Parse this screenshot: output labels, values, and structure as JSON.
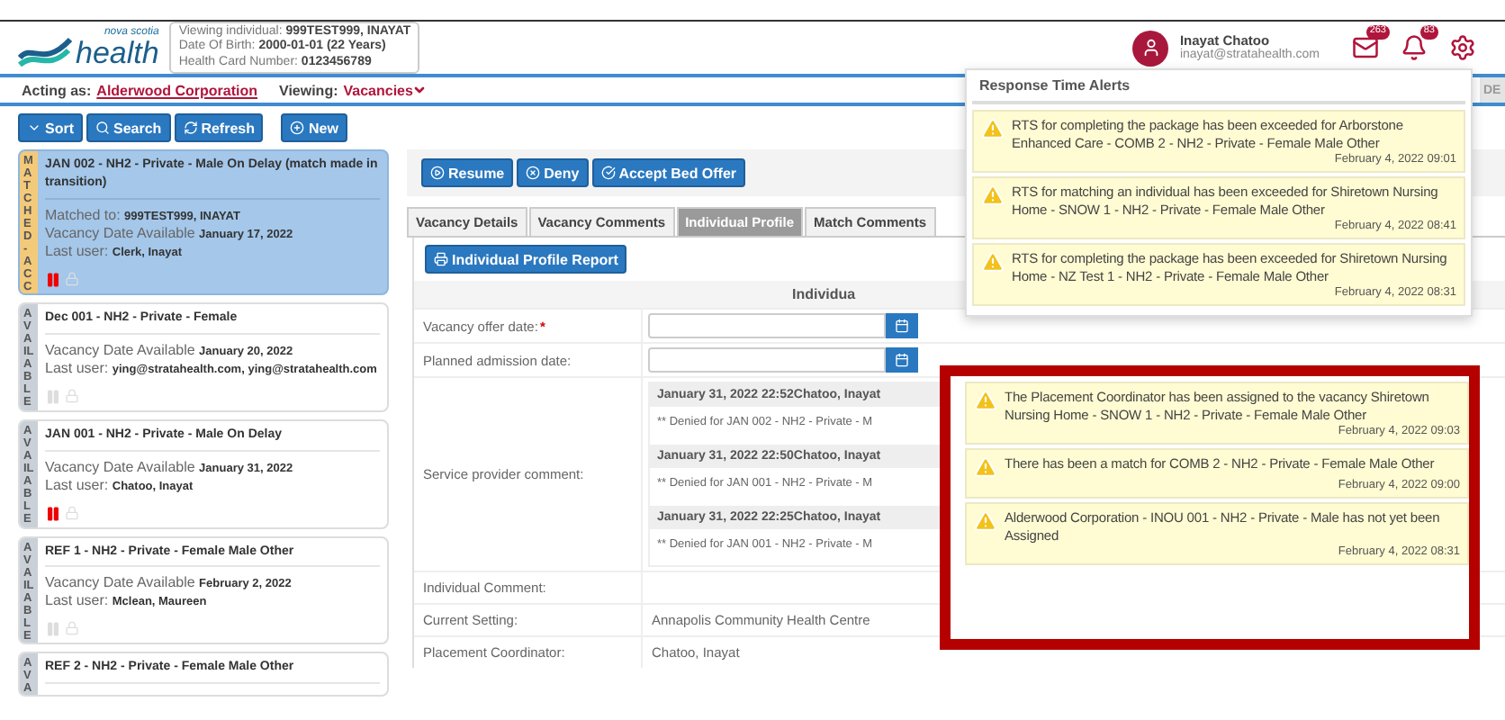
{
  "header": {
    "logo": {
      "small": "nova scotia",
      "large": "health"
    },
    "individual": [
      {
        "label": "Viewing individual:",
        "value": "999TEST999, INAYAT"
      },
      {
        "label": "Date Of Birth:",
        "value": "2000-01-01 (22 Years)"
      },
      {
        "label": "Health Card Number:",
        "value": "0123456789"
      }
    ],
    "user": {
      "name": "Inayat Chatoo",
      "email": "inayat@stratahealth.com"
    },
    "messages_count": "263",
    "alerts_count": "83",
    "env_tag": "DE"
  },
  "context_bar": {
    "acting_label": "Acting as:",
    "acting_value": "Alderwood Corporation",
    "viewing_label": "Viewing:",
    "viewing_value": "Vacancies"
  },
  "toolbar": [
    "Sort",
    "Search",
    "Refresh",
    "New"
  ],
  "vacancies": [
    {
      "status": "MATCHED-ACC",
      "kind": "matched",
      "selected": true,
      "title": "JAN 002 - NH2 - Private - Male On Delay (match made in transition)",
      "lines": [
        {
          "label": "Matched to:",
          "value": "999TEST999, INAYAT"
        },
        {
          "label": "Vacancy Date Available",
          "value": "January 17, 2022"
        },
        {
          "label": "Last user:",
          "value": "Clerk, Inayat"
        }
      ],
      "paused": true
    },
    {
      "status": "AVAILABLE",
      "kind": "available",
      "selected": false,
      "title": "Dec 001 - NH2 - Private - Female",
      "lines": [
        {
          "label": "Vacancy Date Available",
          "value": "January 20, 2022"
        },
        {
          "label": "Last user:",
          "value": "ying@stratahealth.com, ying@stratahealth.com"
        }
      ],
      "paused": false
    },
    {
      "status": "AVAILABLE",
      "kind": "available",
      "selected": false,
      "title": "JAN 001 - NH2 - Private - Male On Delay",
      "lines": [
        {
          "label": "Vacancy Date Available",
          "value": "January 31, 2022"
        },
        {
          "label": "Last user:",
          "value": "Chatoo, Inayat"
        }
      ],
      "paused": true
    },
    {
      "status": "AVAILABLE",
      "kind": "available",
      "selected": false,
      "title": "REF 1 - NH2 - Private - Female Male Other",
      "lines": [
        {
          "label": "Vacancy Date Available",
          "value": "February 2, 2022"
        },
        {
          "label": "Last user:",
          "value": "Mclean, Maureen"
        }
      ],
      "paused": false
    },
    {
      "status": "AVA",
      "kind": "available",
      "selected": false,
      "title": "REF 2 - NH2 - Private - Female Male Other"
    }
  ],
  "actions": [
    "Resume",
    "Deny",
    "Accept Bed Offer"
  ],
  "tabs": [
    {
      "label": "Vacancy Details",
      "selected": false
    },
    {
      "label": "Vacancy Comments",
      "selected": false
    },
    {
      "label": "Individual Profile",
      "selected": true
    },
    {
      "label": "Match Comments",
      "selected": false
    }
  ],
  "report_button": "Individual Profile Report",
  "profile": {
    "section_title": "Individua",
    "fields": [
      {
        "kind": "date",
        "label": "Vacancy offer date:",
        "required_mark": "*"
      },
      {
        "kind": "date",
        "label": "Planned admission date:"
      },
      {
        "kind": "comments",
        "label": "Service provider comment:",
        "comments": [
          {
            "header": "January 31, 2022 22:52Chatoo, Inayat",
            "text": "** Denied for JAN 002 - NH2 - Private - M"
          },
          {
            "header": "January 31, 2022 22:50Chatoo, Inayat",
            "text": "** Denied for JAN 001 - NH2 - Private - M"
          },
          {
            "header": "January 31, 2022 22:25Chatoo, Inayat",
            "text": "** Denied for JAN 001 - NH2 - Private - M"
          }
        ]
      },
      {
        "kind": "text",
        "label": "Individual Comment:"
      },
      {
        "kind": "text",
        "label": "Current Setting:",
        "value": "Annapolis Community Health Centre"
      },
      {
        "kind": "text",
        "label": "Placement Coordinator:",
        "value": "Chatoo, Inayat"
      }
    ]
  },
  "alerts_panel": {
    "title": "Response Time Alerts",
    "alerts": [
      {
        "text": "RTS for completing the package has been exceeded for Arborstone Enhanced Care - COMB 2 - NH2 - Private - Female Male Other",
        "time": "February 4, 2022 09:01"
      },
      {
        "text": "RTS for matching an individual has been exceeded for Shiretown Nursing Home - SNOW 1 - NH2 - Private - Female Male Other",
        "time": "February 4, 2022 08:41"
      },
      {
        "text": "RTS for completing the package has been exceeded for Shiretown Nursing Home - NZ Test 1 - NH2 - Private - Female Male Other",
        "time": "February 4, 2022 08:31"
      }
    ]
  },
  "highlighted_alerts": [
    {
      "text": "The Placement Coordinator has been assigned to the vacancy Shiretown Nursing Home - SNOW 1 - NH2 - Private - Female Male Other",
      "time": "February 4, 2022 09:03"
    },
    {
      "text": "There has been a match for COMB 2 - NH2 - Private - Female Male Other",
      "time": "February 4, 2022 09:00"
    },
    {
      "text": "Alderwood Corporation - INOU 001 - NH2 - Private - Male has not yet been Assigned",
      "time": "February 4, 2022 08:31"
    }
  ]
}
